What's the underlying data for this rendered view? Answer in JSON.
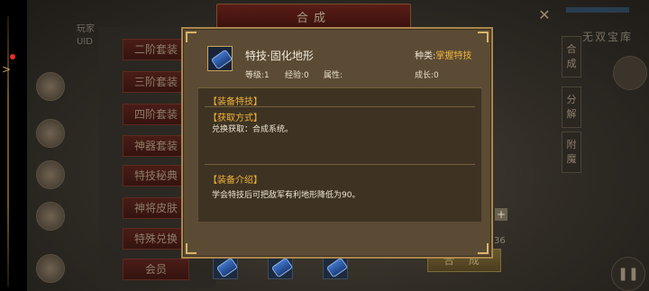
{
  "background": {
    "window_title": "合成",
    "left_info": [
      "玩家",
      "UID"
    ],
    "menu": [
      "二阶套装",
      "三阶套装",
      "四阶套装",
      "神器套装",
      "特技秘典",
      "神将皮肤",
      "特殊兑换",
      "会员"
    ],
    "right_tabs": [
      "合成",
      "分解",
      "附魔"
    ],
    "right_label": "无双宝库",
    "compose_button": "合 成",
    "count": "36",
    "plus": "+"
  },
  "popup": {
    "item_name": "特技·固化地形",
    "kind_label": "种类:",
    "kind_value": "掌握特技",
    "level": "等级:1",
    "exp": "经验:0",
    "attribute": "属性:",
    "growth": "成长:0",
    "sections": [
      {
        "title": "【装备特技】",
        "text": ""
      },
      {
        "title": "【获取方式】",
        "text": "兑换获取：合成系统。"
      },
      {
        "title": "【装备介绍】",
        "text": "学会特技后可把敌军有利地形降低为90。"
      }
    ]
  },
  "colors": {
    "accent_gold": "#f0b23a",
    "popup_bg": "#5b4b35",
    "border_gold": "#a8874f"
  }
}
